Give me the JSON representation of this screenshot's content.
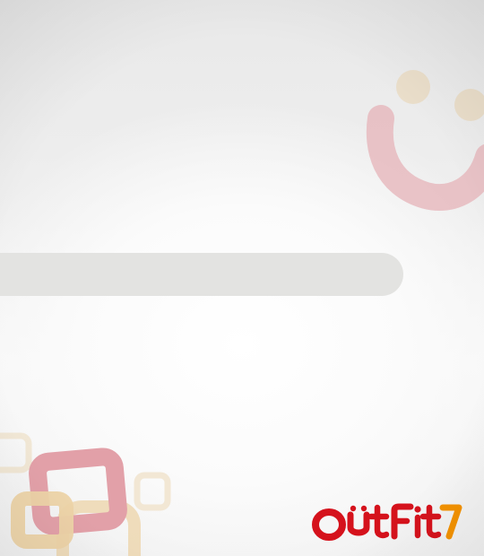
{
  "splash": {
    "background_color": "#f6f6f6",
    "loading": {
      "progress": 0.0,
      "track_color": "#e3e3e1"
    },
    "decorations": {
      "smile_icon": "smile-icon",
      "squares_icon": "rounded-squares-icon",
      "smile_arc_color": "#e6b3b8",
      "smile_dot_color": "#eadcc4",
      "square_red_color": "#e2a0a8",
      "square_gold_color": "#ecd3a7"
    },
    "logo": {
      "word": "OUTFIT",
      "digit": "7",
      "brand_red": "#d5121c",
      "brand_orange": "#f39200"
    }
  }
}
